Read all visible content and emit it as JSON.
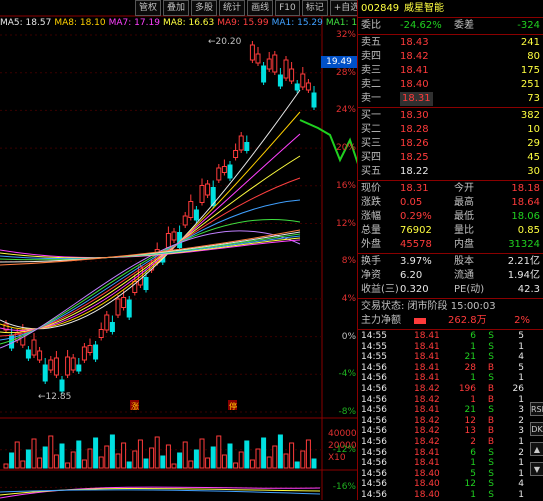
{
  "toolbar": [
    "管权",
    "叠加",
    "多股",
    "统计",
    "画线",
    "F10",
    "标记",
    "+自选",
    "返回"
  ],
  "ma_legend": [
    {
      "label": "MA5: 18.57",
      "color": "#e8e8e8"
    },
    {
      "label": "MA8: 18.10",
      "color": "#ffd000"
    },
    {
      "label": "MA7: 17.19",
      "color": "#ff40ff"
    },
    {
      "label": "MA8: 16.63",
      "color": "#ffff40"
    },
    {
      "label": "MA9: 15.99",
      "color": "#ff4040"
    },
    {
      "label": "MA1: 15.29",
      "color": "#40a0ff"
    },
    {
      "label": "MA1: 15.66",
      "color": "#40e040"
    },
    {
      "label": "MA1",
      "color": "#e8e8e8"
    }
  ],
  "chart": {
    "high_label": "20.20",
    "low_label": "12.85",
    "price_tag": "19.49",
    "pct_axis": [
      {
        "v": "32%",
        "cls": "pos"
      },
      {
        "v": "28%",
        "cls": "pos"
      },
      {
        "v": "24%",
        "cls": "pos"
      },
      {
        "v": "20%",
        "cls": "pos"
      },
      {
        "v": "16%",
        "cls": "pos"
      },
      {
        "v": "12%",
        "cls": "pos"
      },
      {
        "v": "8%",
        "cls": "pos"
      },
      {
        "v": "4%",
        "cls": "pos"
      },
      {
        "v": "0%",
        "cls": "zero"
      },
      {
        "v": "-4%",
        "cls": "neg"
      },
      {
        "v": "-8%",
        "cls": "neg"
      },
      {
        "v": "-12%",
        "cls": "neg"
      },
      {
        "v": "-16%",
        "cls": "neg"
      }
    ],
    "vol_axis": [
      "40000",
      "20000",
      "X10"
    ],
    "marker1": "涨",
    "marker2": "停"
  },
  "quote": {
    "code": "002849",
    "name": "威星智能",
    "weibi_label": "委比",
    "weibi_val": "-24.62%",
    "weicha_label": "委差",
    "weicha_val": "-324",
    "asks": [
      {
        "label": "卖五",
        "price": "18.43",
        "vol": "241"
      },
      {
        "label": "卖四",
        "price": "18.42",
        "vol": "80"
      },
      {
        "label": "卖三",
        "price": "18.41",
        "vol": "175"
      },
      {
        "label": "卖二",
        "price": "18.40",
        "vol": "251"
      },
      {
        "label": "卖一",
        "price": "18.31",
        "vol": "73"
      }
    ],
    "bids": [
      {
        "label": "买一",
        "price": "18.30",
        "vol": "382"
      },
      {
        "label": "买二",
        "price": "18.28",
        "vol": "10"
      },
      {
        "label": "买三",
        "price": "18.26",
        "vol": "29"
      },
      {
        "label": "买四",
        "price": "18.25",
        "vol": "45"
      },
      {
        "label": "买五",
        "price": "18.22",
        "vol": "30"
      }
    ],
    "stats": [
      {
        "l1": "现价",
        "v1": "18.31",
        "c1": "red",
        "l2": "今开",
        "v2": "18.18",
        "c2": "red"
      },
      {
        "l1": "涨跌",
        "v1": "0.05",
        "c1": "red",
        "l2": "最高",
        "v2": "18.64",
        "c2": "red"
      },
      {
        "l1": "涨幅",
        "v1": "0.29%",
        "c1": "red",
        "l2": "最低",
        "v2": "18.06",
        "c2": "green"
      },
      {
        "l1": "总量",
        "v1": "76902",
        "c1": "yellow",
        "l2": "量比",
        "v2": "0.85",
        "c2": "yellow"
      },
      {
        "l1": "外盘",
        "v1": "45578",
        "c1": "red",
        "l2": "内盘",
        "v2": "31324",
        "c2": "green"
      }
    ],
    "stats2": [
      {
        "l1": "换手",
        "v1": "3.97%",
        "c1": "white",
        "l2": "股本",
        "v2": "2.21亿",
        "c2": "white"
      },
      {
        "l1": "净资",
        "v1": "6.20",
        "c1": "white",
        "l2": "流通",
        "v2": "1.94亿",
        "c2": "white"
      },
      {
        "l1": "收益(三)",
        "v1": "0.320",
        "c1": "white",
        "l2": "PE(动)",
        "v2": "42.3",
        "c2": "white"
      }
    ],
    "status": "交易状态: 闭市阶段 15:00:03",
    "main_net_label": "主力净额",
    "main_net_val": "262.8万",
    "main_net_pct": "2%",
    "ticks": [
      {
        "t": "14:55",
        "p": "18.41",
        "v": "6",
        "s": "S",
        "n": "5"
      },
      {
        "t": "14:55",
        "p": "18.41",
        "v": "1",
        "s": "S",
        "n": "1"
      },
      {
        "t": "14:55",
        "p": "18.41",
        "v": "21",
        "s": "S",
        "n": "4"
      },
      {
        "t": "14:56",
        "p": "18.41",
        "v": "28",
        "s": "B",
        "n": "5"
      },
      {
        "t": "14:56",
        "p": "18.41",
        "v": "1",
        "s": "S",
        "n": "1"
      },
      {
        "t": "14:56",
        "p": "18.42",
        "v": "196",
        "s": "B",
        "n": "26"
      },
      {
        "t": "14:56",
        "p": "18.42",
        "v": "1",
        "s": "B",
        "n": "1"
      },
      {
        "t": "14:56",
        "p": "18.41",
        "v": "21",
        "s": "S",
        "n": "3"
      },
      {
        "t": "14:56",
        "p": "18.42",
        "v": "12",
        "s": "B",
        "n": "2"
      },
      {
        "t": "14:56",
        "p": "18.42",
        "v": "13",
        "s": "B",
        "n": "3"
      },
      {
        "t": "14:56",
        "p": "18.42",
        "v": "2",
        "s": "B",
        "n": "1"
      },
      {
        "t": "14:56",
        "p": "18.41",
        "v": "6",
        "s": "S",
        "n": "2"
      },
      {
        "t": "14:56",
        "p": "18.41",
        "v": "1",
        "s": "S",
        "n": "1"
      },
      {
        "t": "14:56",
        "p": "18.40",
        "v": "5",
        "s": "S",
        "n": "1"
      },
      {
        "t": "14:56",
        "p": "18.40",
        "v": "12",
        "s": "S",
        "n": "4"
      },
      {
        "t": "14:56",
        "p": "18.40",
        "v": "1",
        "s": "S",
        "n": "1"
      }
    ],
    "side_icons": [
      "RSI",
      "DK",
      "▲",
      "▼"
    ]
  },
  "colors": {
    "up": "#ff3b3b",
    "down": "#20d020",
    "border": "#8a0000",
    "bg": "#000000"
  }
}
